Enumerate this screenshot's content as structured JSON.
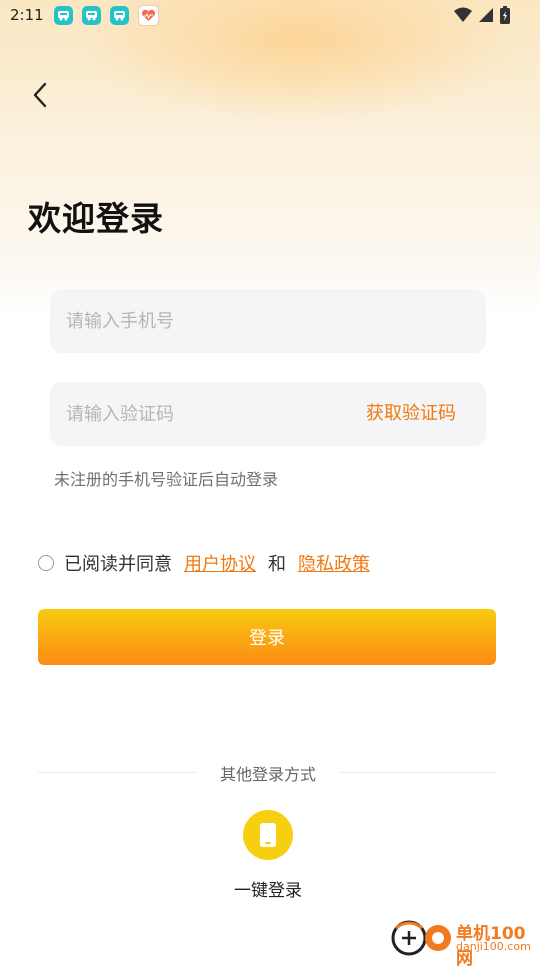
{
  "status_bar": {
    "time": "2:11",
    "icons": [
      "teal-app-icon",
      "teal-app-icon",
      "teal-app-icon",
      "heart-app-icon",
      "wifi-icon",
      "signal-icon",
      "battery-icon"
    ]
  },
  "header": {
    "back_icon": "chevron-left-icon",
    "title": "欢迎登录"
  },
  "form": {
    "phone_placeholder": "请输入手机号",
    "code_placeholder": "请输入验证码",
    "get_code_label": "获取验证码",
    "hint": "未注册的手机号验证后自动登录"
  },
  "agreement": {
    "prefix": "已阅读并同意",
    "user_agreement": "用户协议",
    "and": "和",
    "privacy_policy": "隐私政策",
    "checked": false
  },
  "login_button": "登录",
  "other_login": {
    "label": "其他登录方式",
    "one_click_label": "一键登录",
    "one_click_icon": "phone-icon"
  },
  "watermark": {
    "name": "单机100网",
    "url": "danji100.com"
  },
  "colors": {
    "accent": "#f07a10",
    "button_top": "#f8cb10",
    "button_bottom": "#fc8d16",
    "one_click_bg": "#f6cf10"
  }
}
